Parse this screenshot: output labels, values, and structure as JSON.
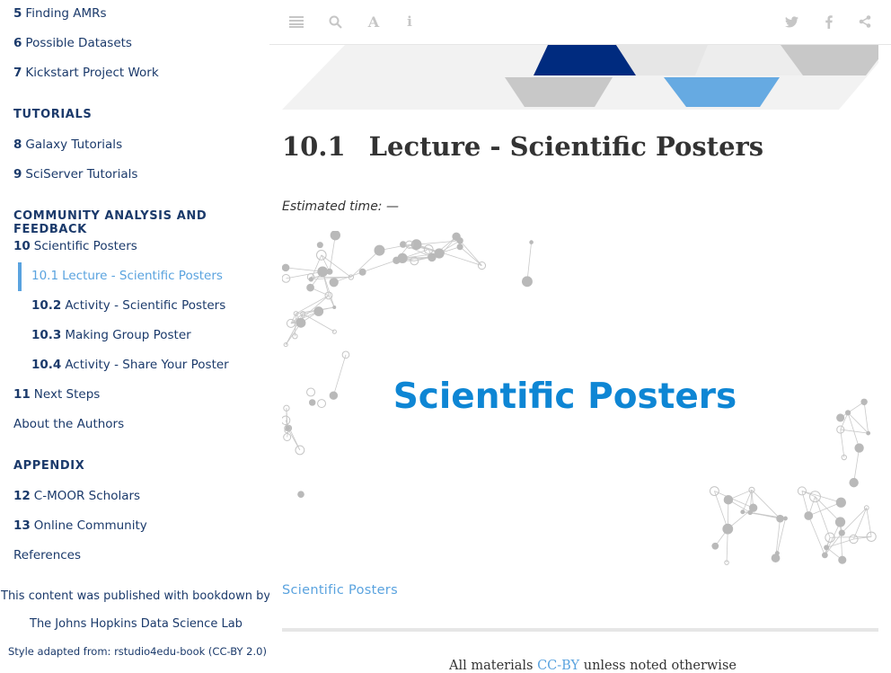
{
  "sidebar": {
    "items_top": [
      {
        "num": "5",
        "label": "Finding AMRs"
      },
      {
        "num": "6",
        "label": "Possible Datasets"
      },
      {
        "num": "7",
        "label": "Kickstart Project Work"
      }
    ],
    "tutorials_header": "TUTORIALS",
    "tutorials": [
      {
        "num": "8",
        "label": "Galaxy Tutorials"
      },
      {
        "num": "9",
        "label": "SciServer Tutorials"
      }
    ],
    "community_header": "COMMUNITY ANALYSIS AND FEEDBACK",
    "chapter10": {
      "num": "10",
      "label": "Scientific Posters"
    },
    "subsections": [
      {
        "num": "10.1",
        "label": "Lecture - Scientific Posters"
      },
      {
        "num": "10.2",
        "label": "Activity - Scientific Posters"
      },
      {
        "num": "10.3",
        "label": "Making Group Poster"
      },
      {
        "num": "10.4",
        "label": "Activity - Share Your Poster"
      }
    ],
    "chapter11": {
      "num": "11",
      "label": "Next Steps"
    },
    "about": "About the Authors",
    "appendix_header": "APPENDIX",
    "appendix": [
      {
        "num": "12",
        "label": "C-MOOR Scholars"
      },
      {
        "num": "13",
        "label": "Online Community"
      }
    ],
    "references": "References",
    "footer": {
      "published": "This content was published with bookdown by:",
      "lab": "The Johns Hopkins Data Science Lab",
      "style": "Style adapted from: rstudio4edu-book (CC-BY 2.0)"
    }
  },
  "toolbar": {
    "icons": [
      "toggle-sidebar-icon",
      "search-icon",
      "font-settings-icon",
      "info-icon",
      "twitter-icon",
      "facebook-icon",
      "share-icon"
    ]
  },
  "main": {
    "chapter_num": "10.1",
    "chapter_title": "Lecture - Scientific Posters",
    "estimated_time": "Estimated time: —",
    "slide_title": "Scientific Posters",
    "caption_link": "Scientific Posters",
    "license_prefix": "All materials",
    "license_link": "CC-BY",
    "license_suffix": "unless noted otherwise"
  },
  "colors": {
    "navy": "#1b3a6b",
    "accent": "#5aa3df",
    "slide_title": "#0e86d4",
    "banner_dark": "#002b7f",
    "banner_light_blue": "#66aae2"
  }
}
